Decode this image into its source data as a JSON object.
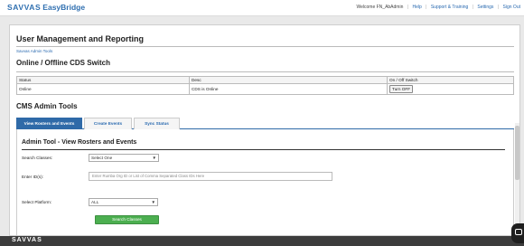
{
  "brand": {
    "name": "SAVVAS",
    "product": "EasyBridge"
  },
  "topnav": {
    "welcome": "Welcome FN_AbAdmin",
    "help": "Help",
    "support": "Support & Training",
    "settings": "Settings",
    "signout": "Sign Out"
  },
  "page": {
    "title": "User Management and Reporting",
    "breadcrumb": "Savvas Admin Tools"
  },
  "cds": {
    "title": "Online / Offline CDS Switch",
    "headers": [
      "Status",
      "Desc",
      "On / Off Switch"
    ],
    "row": {
      "status": "Online",
      "desc": "CDS is Online",
      "button": "Turn OFF"
    }
  },
  "cms": {
    "title": "CMS Admin Tools",
    "tabs": [
      "View Rosters and Events",
      "Create Events",
      "Sync Status"
    ],
    "active_tab": 0
  },
  "panel": {
    "title": "Admin Tool - View Rosters and Events",
    "search_classes_label": "Search Classes:",
    "search_classes_value": "Select One",
    "enter_ids_label": "Enter ID(s):",
    "enter_ids_placeholder": "Enter Rumba Org ID or List of Comma Separated Class IDs Here",
    "platform_label": "Select Platform:",
    "platform_value": "ALL",
    "search_button": "Search Classes"
  },
  "footer": {
    "brand": "SAVVAS"
  },
  "colors": {
    "accent": "#2f6aa8",
    "success": "#4caf50",
    "footer": "#3c3c3c"
  }
}
